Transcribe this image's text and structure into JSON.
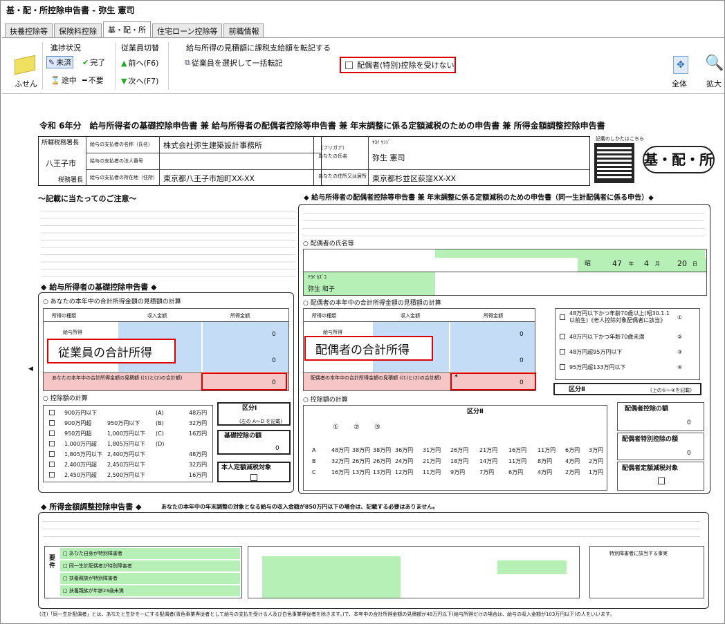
{
  "window": {
    "title": "基・配・所控除申告書 - 弥生 憲司"
  },
  "tabs": [
    "扶養控除等",
    "保険料控除",
    "基・配・所",
    "住宅ローン控除等",
    "前職情報"
  ],
  "toolbar": {
    "fusen": "ふせん",
    "progress_title": "進捗状況",
    "mishu": "未済",
    "kanryo": "完了",
    "tochu": "途中",
    "fuyo": "不要",
    "emp_title": "従業員切替",
    "prev": "前へ(F6)",
    "next": "次へ(F7)",
    "transfer_title": "給与所得の見積額に課税支給額を転記する",
    "transfer_btn": "従業員を選択して一括転記",
    "spouse_checkbox": "配偶者(特別)控除を受けない",
    "zentai": "全体",
    "kakudai": "拡大"
  },
  "form": {
    "title": "令和 6年分　給与所得者の基礎控除申告書 兼 給与所得者の配偶者控除等申告書 兼 年末調整に係る定額減税のための申告書 兼 所得金額調整控除申告書",
    "tax_office_head": "所轄税務署長",
    "tax_office": "八王子市",
    "tax_office_suffix": "税務署長",
    "payer_name_label": "給与の支払者の名称（氏名）",
    "payer_name": "株式会社弥生建築設計事務所",
    "payer_no_label": "給与の支払者の法人番号",
    "payer_addr_label": "給与の支払者の所在地（住所）",
    "payer_addr": "東京都八王子市旭町XX-XX",
    "furigana_label": "（フリガナ）",
    "name_label": "あなたの氏名",
    "furigana": "ﾔﾖｲ ｹﾝｼﾞ",
    "name": "弥生 憲司",
    "addr_label": "あなたの住所又は居所",
    "addr": "東京都杉並区荻窪XX-XX",
    "qr_label": "記載のしかたはこちら",
    "badge": "基・配・所",
    "notes_title": "～記載に当たってのご注意～",
    "basic_title": "◆ 給与所得者の基礎控除申告書 ◆",
    "income_calc": "○ あなたの本年中の合計所得金額の見積額の計算",
    "kind": "所得の種類",
    "revenue": "収入金額",
    "income": "所得金額",
    "salary": "給与所得",
    "emp_total_label": "従業員の合計所得",
    "total_label": "あなたの本年中の合計所得金額の見積額 ((1)と(2)の合計額)",
    "yen0": "0",
    "deduction_calc": "○ 控除額の計算",
    "div1": "区分Ⅰ",
    "div1_note": "(左の A～D を記載)",
    "basic_ded": "基礎控除の額",
    "teigaku": "本人定額減税対象",
    "brackets": [
      [
        "900万円以下",
        "",
        "(A)",
        "48万円"
      ],
      [
        "900万円超",
        "950万円以下",
        "(B)",
        "32万円"
      ],
      [
        "950万円超",
        "1,000万円以下",
        "(C)",
        "16万円"
      ],
      [
        "1,000万円超",
        "1,805万円以下",
        "(D)",
        ""
      ],
      [
        "1,805万円以下",
        "2,400万円以下",
        "",
        "48万円"
      ],
      [
        "2,400万円超",
        "2,450万円以下",
        "",
        "32万円"
      ],
      [
        "2,450万円超",
        "2,500万円以下",
        "",
        "16万円"
      ]
    ],
    "spouse_title": "◆ 給与所得者の配偶者控除等申告書 兼 年末調整に係る定額減税のための申告書（同一生計配偶者に係る申告）◆",
    "spouse_name_title": "○ 配偶者の氏名等",
    "spouse_furigana": "ﾔﾖｲ ｶｽﾞｺ",
    "spouse_name": "弥生 和子",
    "spouse_era": "昭",
    "spouse_y": "47",
    "spouse_m": "4",
    "spouse_d": "20",
    "nen": "年",
    "tsuki": "月",
    "hi": "日",
    "spouse_income_calc": "○ 配偶者の本年中の合計所得金額の見積額の計算",
    "spouse_total_label": "配偶者の合計所得",
    "spouse_total_text": "配偶者の本年中の合計所得金額の見積額 ((1)と(2)の合計額)",
    "asterisk": "*",
    "judge": [
      "48万円以下かつ年齢70歳以上(昭30.1.1以前生)《老人控除対象配偶者に該当》",
      "48万円以下かつ年齢70歳未満",
      "48万円超95万円以下",
      "95万円超133万円以下"
    ],
    "judge_no": [
      "①",
      "②",
      "③",
      "④"
    ],
    "div2": "区分Ⅱ",
    "div2_note": "(上の①～④を記載)",
    "spouse_ded_head": "区分Ⅱ",
    "grid_heads": [
      "①",
      "②",
      "③"
    ],
    "grid_rows": [
      [
        "A",
        "48万円",
        "38万円",
        "38万円",
        "36万円",
        "31万円",
        "26万円",
        "21万円",
        "16万円",
        "11万円",
        "6万円",
        "3万円"
      ],
      [
        "B",
        "32万円",
        "26万円",
        "26万円",
        "24万円",
        "21万円",
        "18万円",
        "14万円",
        "11万円",
        "8万円",
        "4万円",
        "2万円"
      ],
      [
        "C",
        "16万円",
        "13万円",
        "13万円",
        "12万円",
        "11万円",
        "9万円",
        "7万円",
        "6万円",
        "4万円",
        "2万円",
        "1万円"
      ]
    ],
    "spouse_ded": "配偶者控除の額",
    "spouse_special": "配偶者特別控除の額",
    "spouse_teigaku": "配偶者定額減税対象",
    "adjust_title": "◆ 所得金額調整控除申告書 ◆",
    "adjust_note": "あなたの本年中の年末調整の対象となる給与の収入金額が850万円以下の場合は、記載する必要はありません。",
    "reqs": [
      "□ あなた自身が特別障害者",
      "□ 同一生計配偶者が特別障害者",
      "□ 扶養親族が特別障害者",
      "□ 扶養親族が年齢23歳未満"
    ],
    "req_label": "要件",
    "tokubetsu": "特別障害者に該当する事実",
    "footer": "(注)「同一生計配偶者」とは、あなたと生計を一にする配偶者(青色事業専従者として給与の支払を受ける人及び白色事業専従者を除きます。)で、本年中の合計所得金額の見積額が48万円以下(給与所得だけの場合は、給与の収入金額が103万円以下)の人をいいます。"
  }
}
